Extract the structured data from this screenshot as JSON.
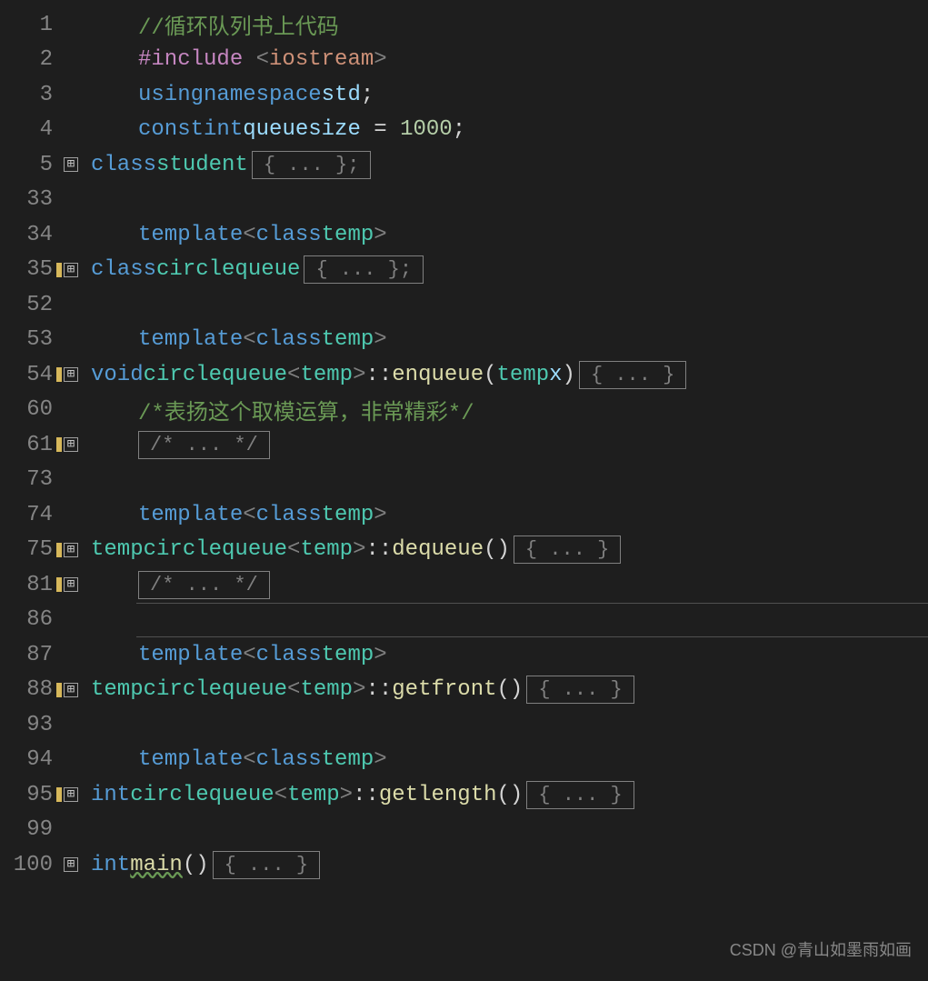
{
  "lines": {
    "l1": {
      "num": "1"
    },
    "l2": {
      "num": "2"
    },
    "l3": {
      "num": "3"
    },
    "l4": {
      "num": "4"
    },
    "l5": {
      "num": "5"
    },
    "l33": {
      "num": "33"
    },
    "l34": {
      "num": "34"
    },
    "l35": {
      "num": "35"
    },
    "l52": {
      "num": "52"
    },
    "l53": {
      "num": "53"
    },
    "l54": {
      "num": "54"
    },
    "l60": {
      "num": "60"
    },
    "l61": {
      "num": "61"
    },
    "l73": {
      "num": "73"
    },
    "l74": {
      "num": "74"
    },
    "l75": {
      "num": "75"
    },
    "l81": {
      "num": "81"
    },
    "l86": {
      "num": "86"
    },
    "l87": {
      "num": "87"
    },
    "l88": {
      "num": "88"
    },
    "l93": {
      "num": "93"
    },
    "l94": {
      "num": "94"
    },
    "l95": {
      "num": "95"
    },
    "l99": {
      "num": "99"
    },
    "l100": {
      "num": "100"
    }
  },
  "tokens": {
    "comment1": "//循环队列书上代码",
    "include": "#include ",
    "iostream_l": "<",
    "iostream": "iostream",
    "iostream_r": ">",
    "using": "using",
    "namespace": "namespace",
    "std": "std",
    "semi": ";",
    "const": "const",
    "int": "int",
    "queuesize": "queuesize",
    "eq": " = ",
    "thousand": "1000",
    "class": "class",
    "student": "student",
    "template": "template",
    "lt": "<",
    "gt": ">",
    "temp": "temp",
    "circlequeue": "circlequeue",
    "void": "void",
    "coloncolon": "::",
    "enqueue": "enqueue",
    "lparen": "(",
    "rparen": ")",
    "x": "x",
    "comment60": "/*表扬这个取模运算，非常精彩*/",
    "dequeue": "dequeue",
    "getfront": "getfront",
    "getlength": "getlength",
    "main": "main",
    "fold_brace_semi": "{ ... };",
    "fold_brace": "{ ... }",
    "fold_comment": "/* ... */",
    "fold_glyph": "⊞"
  },
  "watermark": "CSDN @青山如墨雨如画"
}
